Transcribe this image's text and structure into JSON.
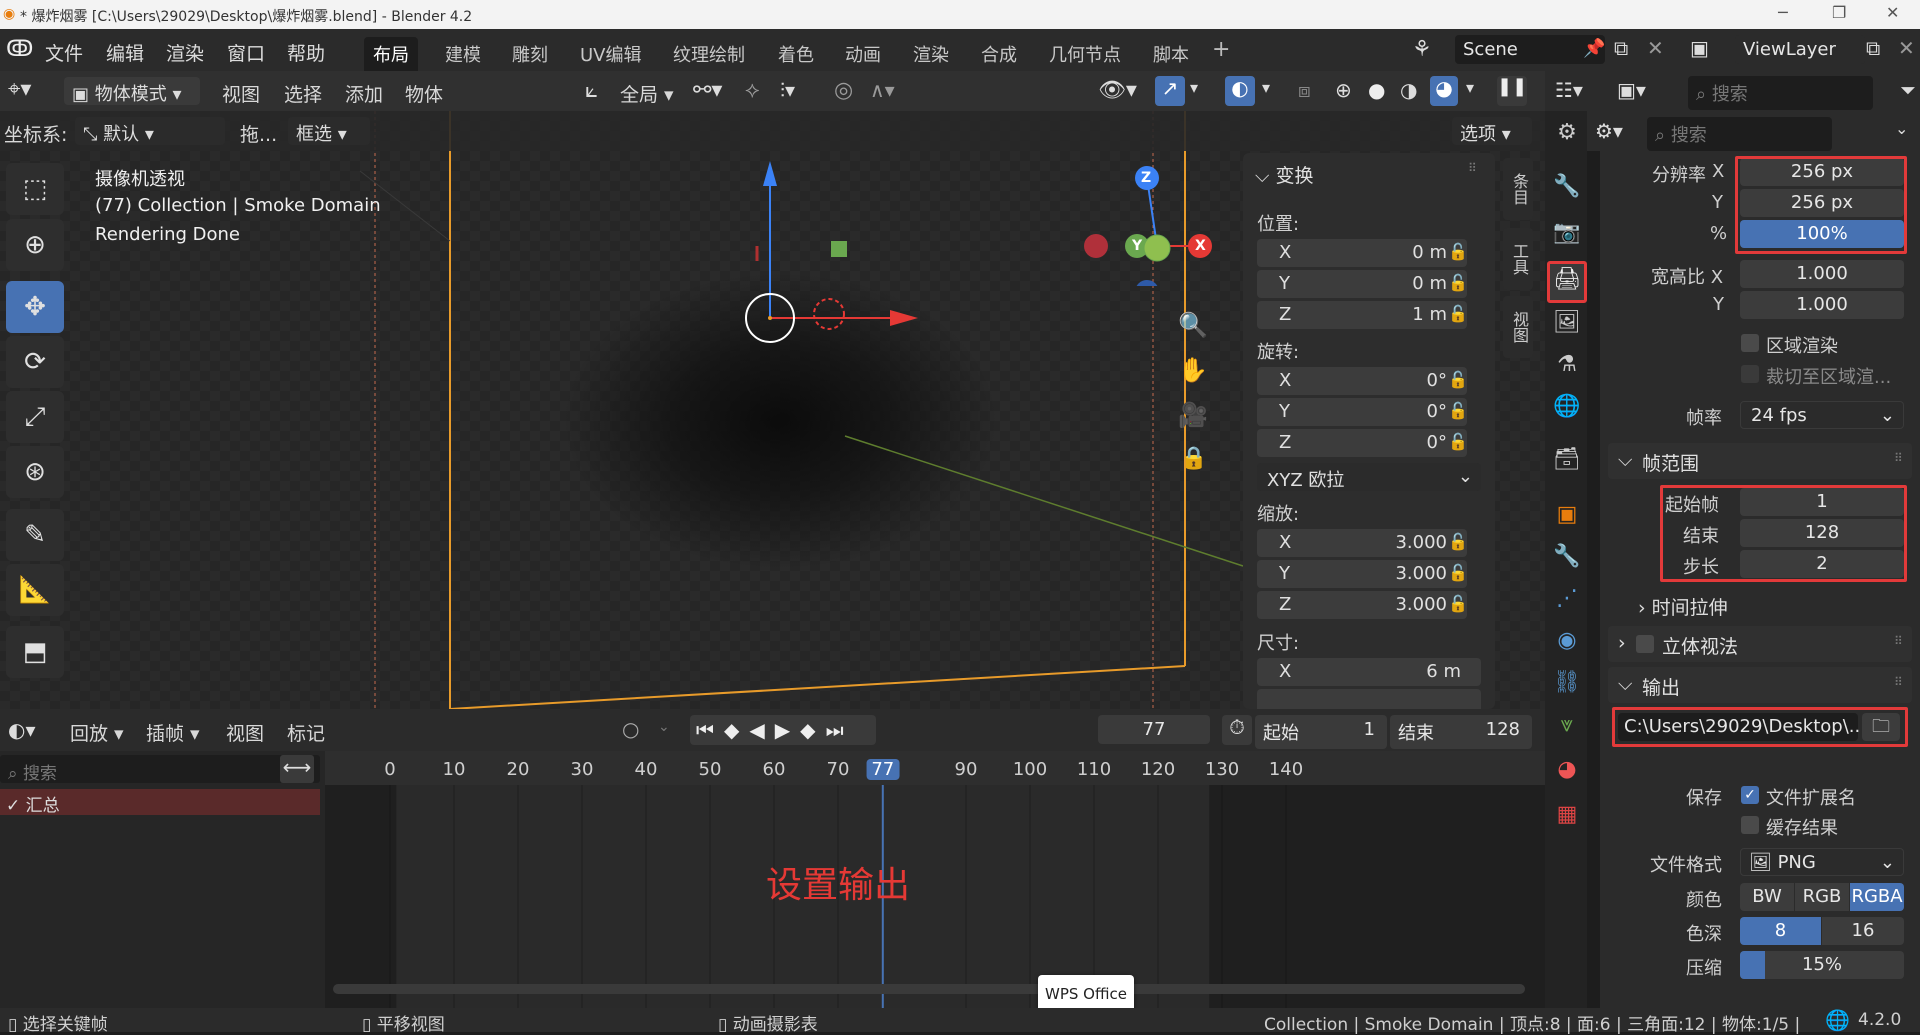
{
  "window": {
    "title": "* 爆炸烟雾 [C:\\Users\\29029\\Desktop\\爆炸烟雾.blend] - Blender 4.2"
  },
  "menu": [
    "文件",
    "编辑",
    "渲染",
    "窗口",
    "帮助"
  ],
  "workspaces": [
    "布局",
    "建模",
    "雕刻",
    "UV编辑",
    "纹理绘制",
    "着色",
    "动画",
    "渲染",
    "合成",
    "几何节点",
    "脚本"
  ],
  "active_workspace": "布局",
  "scene": "Scene",
  "view_layer": "ViewLayer",
  "viewport_header": {
    "mode": "物体模式",
    "items": [
      "视图",
      "选择",
      "添加",
      "物体"
    ],
    "transform_orientation": "全局",
    "coord_label": "坐标系:",
    "coord_value": "默认",
    "drag_label": "拖...",
    "select_mode": "框选",
    "options": "选项"
  },
  "overlay_text": {
    "line1": "摄像机透视",
    "line2": "(77) Collection | Smoke Domain",
    "line3": "Rendering Done"
  },
  "gizmo_axes": {
    "z": "Z",
    "y": "Y",
    "x": "X"
  },
  "npanel": {
    "header": "变换",
    "location_label": "位置:",
    "location": [
      {
        "k": "X",
        "v": "0 m"
      },
      {
        "k": "Y",
        "v": "0 m"
      },
      {
        "k": "Z",
        "v": "1 m"
      }
    ],
    "rotation_label": "旋转:",
    "rotation": [
      {
        "k": "X",
        "v": "0°"
      },
      {
        "k": "Y",
        "v": "0°"
      },
      {
        "k": "Z",
        "v": "0°"
      }
    ],
    "rotation_mode": "XYZ 欧拉",
    "scale_label": "缩放:",
    "scale": [
      {
        "k": "X",
        "v": "3.000"
      },
      {
        "k": "Y",
        "v": "3.000"
      },
      {
        "k": "Z",
        "v": "3.000"
      }
    ],
    "dimensions_label": "尺寸:",
    "dimensions": [
      {
        "k": "X",
        "v": "6 m"
      }
    ],
    "tabs": [
      "条目",
      "工具",
      "视图"
    ]
  },
  "properties": {
    "search_placeholder": "搜索",
    "resolution_label": "分辨率",
    "res_x_label": "X",
    "res_x": "256 px",
    "res_y_label": "Y",
    "res_y": "256 px",
    "res_pct_label": "%",
    "res_pct": "100%",
    "aspect_label": "宽高比 X",
    "aspect_x": "1.000",
    "aspect_y_label": "Y",
    "aspect_y": "1.000",
    "region_render": "区域渲染",
    "crop_region": "裁切至区域渲...",
    "fps_label": "帧率",
    "fps": "24 fps",
    "frame_range_header": "帧范围",
    "frame_start_label": "起始帧",
    "frame_start": "1",
    "frame_end_label": "结束",
    "frame_end": "128",
    "frame_step_label": "步长",
    "frame_step": "2",
    "time_stretch": "时间拉伸",
    "stereoscopy": "立体视法",
    "output_header": "输出",
    "output_path": "C:\\Users\\29029\\Desktop\\...",
    "save_label": "保存",
    "file_extension": "文件扩展名",
    "cache_result": "缓存结果",
    "file_format_label": "文件格式",
    "file_format": "PNG",
    "color_label": "颜色",
    "color_options": [
      "BW",
      "RGB",
      "RGBA"
    ],
    "color_selected": "RGBA",
    "depth_label": "色深",
    "depth_options": [
      "8",
      "16"
    ],
    "depth_selected": "8",
    "compression_label": "压缩",
    "compression": "15%",
    "compression_fraction": 0.15
  },
  "outliner_search_placeholder": "搜索",
  "timeline": {
    "menus": [
      "回放",
      "插帧",
      "视图",
      "标记"
    ],
    "current_frame": "77",
    "start_label": "起始",
    "start": "1",
    "end_label": "结束",
    "end": "128",
    "ticks": [
      "0",
      "10",
      "20",
      "30",
      "40",
      "50",
      "60",
      "70",
      "77",
      "90",
      "100",
      "110",
      "120",
      "130",
      "140"
    ],
    "search_placeholder": "搜索",
    "summary": "汇总",
    "annotation": "设置输出",
    "tooltip": "WPS Office"
  },
  "status": {
    "left1": "选择关键帧",
    "left2": "平移视图",
    "left3": "动画摄影表",
    "right": "Collection | Smoke Domain | 顶点:8 | 面:6 | 三角面:12 | 物体:1/5 |",
    "version": "4.2.0"
  },
  "colors": {
    "accent": "#4772b3",
    "highlight_red": "#e23a3a",
    "annotation_red": "#e53935"
  }
}
